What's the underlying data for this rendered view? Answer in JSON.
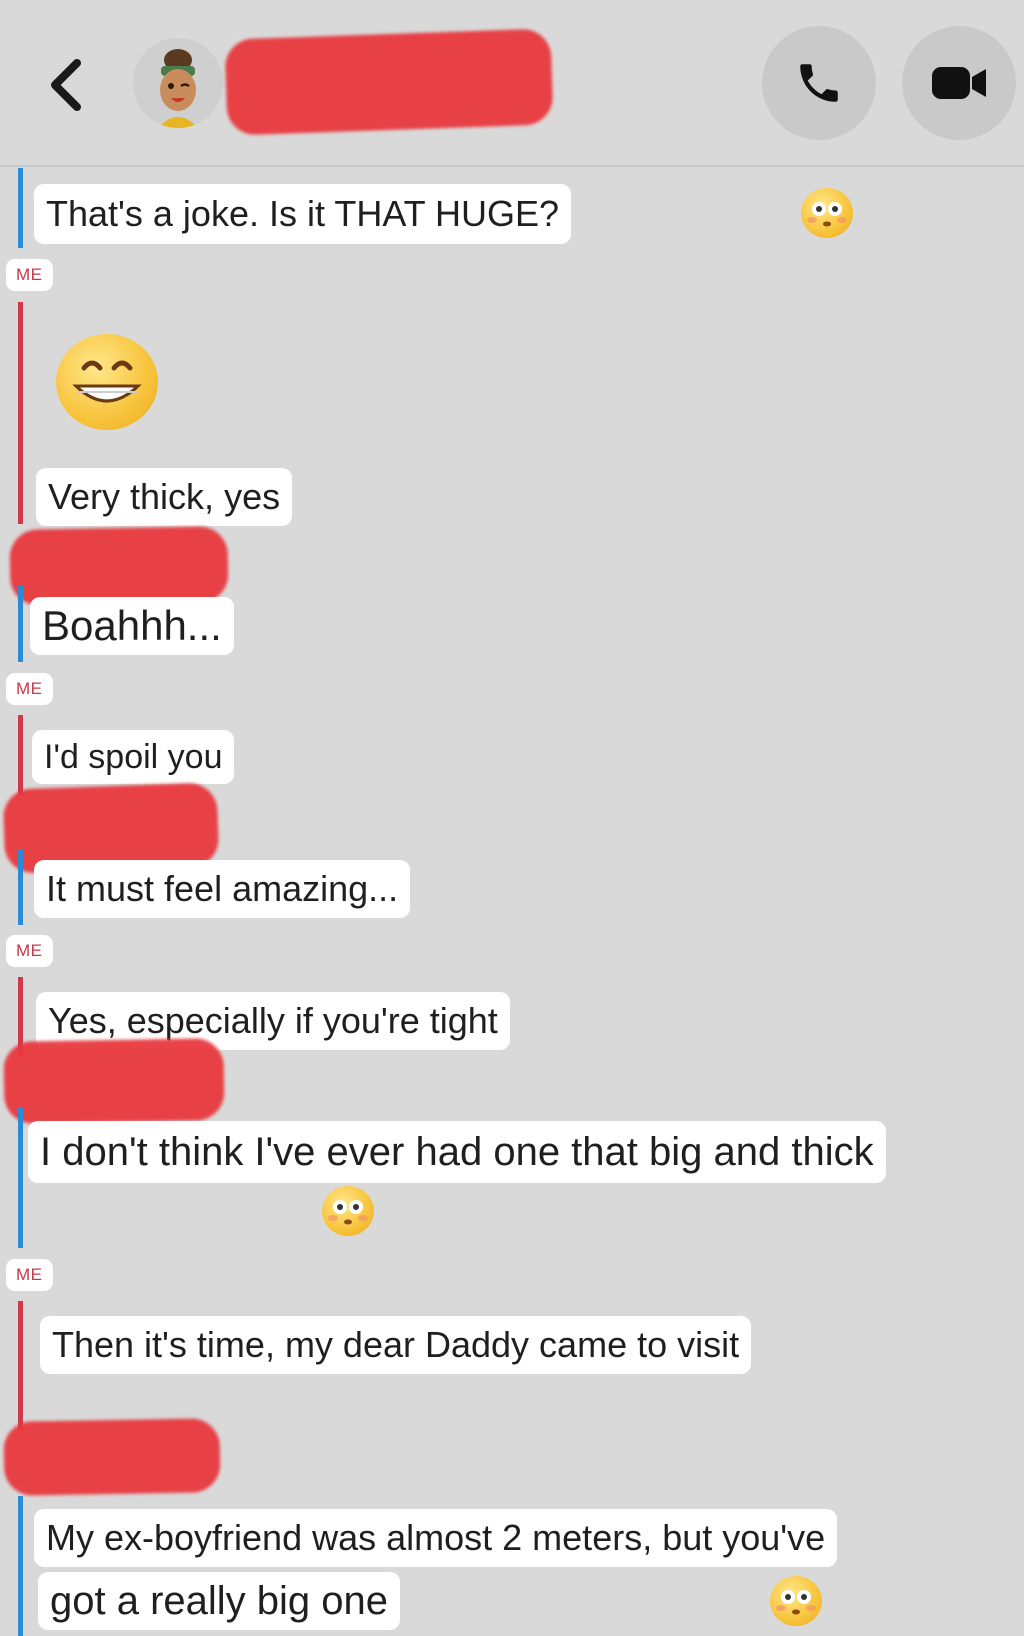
{
  "header": {
    "back_icon": "chevron-left-icon",
    "avatar_icon": "bitmoji-avatar",
    "call_icon": "phone-icon",
    "video_icon": "video-camera-icon"
  },
  "me_label": "ME",
  "messages": [
    {
      "text": "That's a joke. Is it THAT HUGE?",
      "reaction": "flushed-face-emoji"
    },
    {
      "emoji": "grinning-face-emoji"
    },
    {
      "text": "Very thick, yes"
    },
    {
      "text": "Boahhh..."
    },
    {
      "text": "I'd spoil you"
    },
    {
      "text": "It must feel amazing..."
    },
    {
      "text": "Yes, especially if you're tight"
    },
    {
      "text": "I don't think I've ever had one that big and thick",
      "reaction": "flushed-face-emoji"
    },
    {
      "text": "Then it's time, my dear Daddy came to visit"
    },
    {
      "text_line1": "My ex-boyfriend was almost 2 meters, but you've",
      "text_line2": "got a really big one",
      "reaction": "flushed-face-emoji"
    }
  ],
  "colors": {
    "background": "#d9d9d9",
    "them_accent": "#2a8bd6",
    "me_accent": "#d0384b",
    "redaction": "#e8393f"
  }
}
